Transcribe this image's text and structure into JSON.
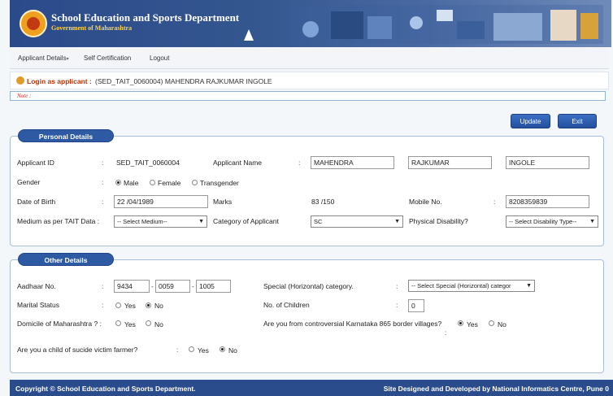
{
  "header": {
    "title": "School Education and Sports Department",
    "subtitle": "Government of Maharashtra"
  },
  "nav": {
    "items": [
      {
        "label": "Applicant Details",
        "icon": "chevron-down-icon"
      },
      {
        "label": "Self Certification"
      },
      {
        "label": "Logout"
      }
    ]
  },
  "login": {
    "label": "Login as applicant :",
    "value": "(SED_TAIT_0060004)  MAHENDRA RAJKUMAR INGOLE"
  },
  "note": "Note :",
  "buttons": {
    "update": "Update",
    "exit": "Exit"
  },
  "personal": {
    "title": "Personal Details",
    "applicant_id_label": "Applicant ID",
    "applicant_id": "SED_TAIT_0060004",
    "applicant_name_label": "Applicant Name",
    "first_name": "MAHENDRA",
    "middle_name": "RAJKUMAR",
    "last_name": "INGOLE",
    "gender_label": "Gender",
    "gender_options": [
      "Male",
      "Female",
      "Transgender"
    ],
    "gender_selected": "Male",
    "dob_label": "Date of Birth",
    "dob": "22 /04/1989",
    "marks_label": "Marks",
    "marks": "83 /150",
    "mobile_label": "Mobile No.",
    "mobile": "8208359839",
    "medium_label": "Medium as per TAIT Data :",
    "medium": "-- Select Medium--",
    "category_label": "Category of Applicant",
    "category": "SC",
    "disability_label": "Physical Disability?",
    "disability": "-- Select Disability Type--"
  },
  "other": {
    "title": "Other Details",
    "aadhaar_label": "Aadhaar No.",
    "aadhaar": [
      "9434",
      "0059",
      "1005"
    ],
    "special_label": "Special (Horizontal) category.",
    "special": "-- Select Special (Horizontal) categor",
    "marital_label": "Marital Status",
    "marital_options": [
      "Yes",
      "No"
    ],
    "marital_selected": "No",
    "children_label": "No. of Children",
    "children": "0",
    "domicile_label": "Domicile of Maharashtra ? :",
    "domicile_options": [
      "Yes",
      "No"
    ],
    "karnataka_label": "Are you from controversial Karnataka 865 border villages?",
    "karnataka_options": [
      "Yes",
      "No"
    ],
    "karnataka_selected": "Yes",
    "farmer_label": "Are you a child of sucide victim farmer?",
    "farmer_options": [
      "Yes",
      "No"
    ],
    "farmer_selected": "No"
  },
  "footer": {
    "left": "Copyright © School Education and Sports Department.",
    "right": "Site Designed and Developed by National Informatics Centre, Pune 0"
  },
  "colors": {
    "header_blue": "#2b4a8a",
    "section_title": "#2d5aa3",
    "footer_blue": "#2a4c8c",
    "login_label": "#c03000"
  }
}
